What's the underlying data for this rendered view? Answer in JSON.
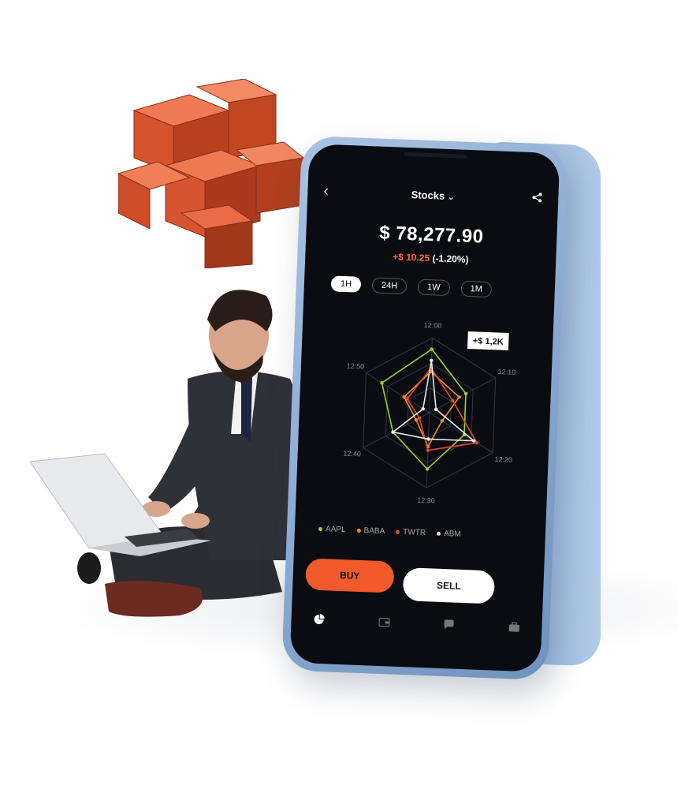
{
  "app": {
    "title": "Stocks",
    "title_chevron": "⌄",
    "back_icon": "back-chevron-icon",
    "share_icon": "share-icon"
  },
  "portfolio": {
    "balance": "$ 78,277.90",
    "change_amount": "+$ 10.25",
    "change_percent": "(-1.20%)"
  },
  "timeframes": [
    {
      "label": "1H",
      "active": true
    },
    {
      "label": "24H",
      "active": false
    },
    {
      "label": "1W",
      "active": false
    },
    {
      "label": "1M",
      "active": false
    }
  ],
  "chart_data": {
    "type": "radar",
    "axes": [
      "12:00",
      "12:10",
      "12:20",
      "12:30",
      "12:40",
      "12:50"
    ],
    "tooltip": "+$ 1,2K",
    "series": [
      {
        "name": "AAPL",
        "color": "#9ad425",
        "values": [
          0.85,
          0.55,
          0.55,
          0.75,
          0.55,
          0.75
        ]
      },
      {
        "name": "BABA",
        "color": "#f08a2a",
        "values": [
          0.55,
          0.45,
          0.2,
          0.45,
          0.2,
          0.4
        ]
      },
      {
        "name": "TWTR",
        "color": "#e24a2a",
        "values": [
          0.6,
          0.35,
          0.75,
          0.5,
          0.15,
          0.35
        ]
      },
      {
        "name": "ABM",
        "color": "#e8e8e8",
        "values": [
          0.7,
          0.1,
          0.7,
          0.35,
          0.55,
          0.1
        ]
      }
    ]
  },
  "actions": {
    "buy_label": "BUY",
    "sell_label": "SELL"
  },
  "bottom_nav": [
    "pie-chart-icon",
    "wallet-icon",
    "chat-icon",
    "briefcase-icon"
  ]
}
